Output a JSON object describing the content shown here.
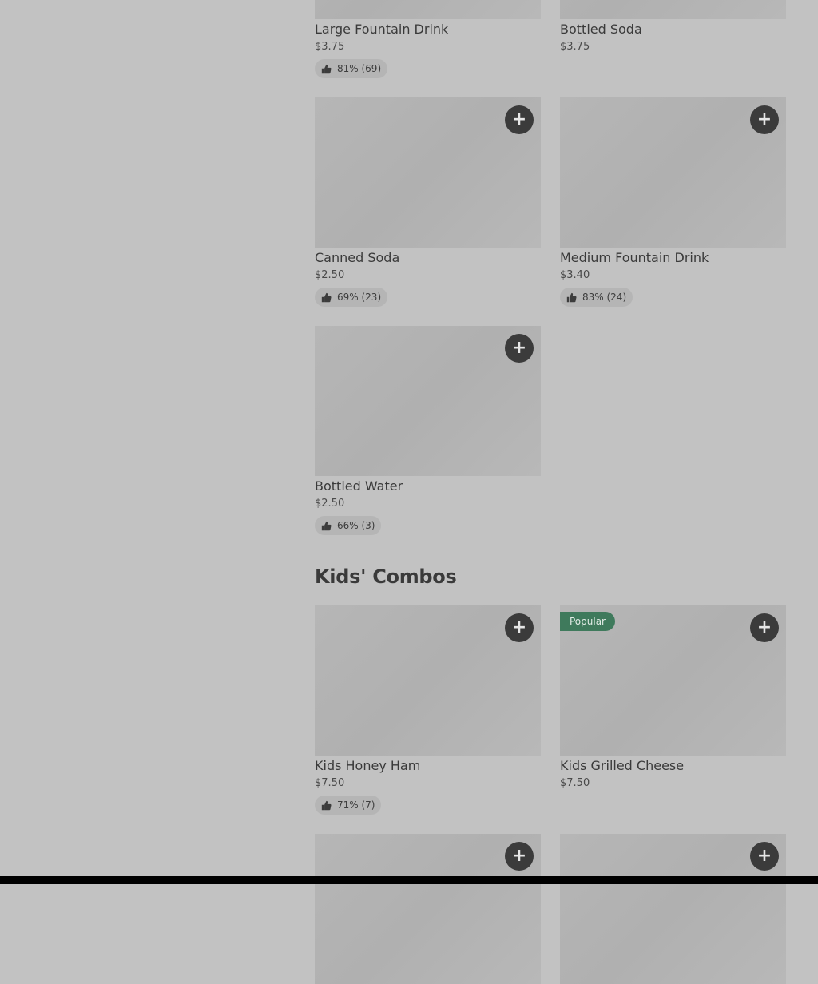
{
  "drinks": {
    "items": [
      {
        "name": "Large Fountain Drink",
        "price": "$3.75",
        "rating": "81% (69)"
      },
      {
        "name": "Bottled Soda",
        "price": "$3.75"
      },
      {
        "name": "Canned Soda",
        "price": "$2.50",
        "rating": "69% (23)"
      },
      {
        "name": "Medium Fountain Drink",
        "price": "$3.40",
        "rating": "83% (24)"
      },
      {
        "name": "Bottled Water",
        "price": "$2.50",
        "rating": "66% (3)"
      }
    ]
  },
  "kids_combos": {
    "title": "Kids' Combos",
    "items": [
      {
        "name": "Kids Honey Ham",
        "price": "$7.50",
        "rating": "71% (7)"
      },
      {
        "name": "Kids Grilled Cheese",
        "price": "$7.50",
        "badge": "Popular"
      }
    ]
  },
  "icons": {
    "add": "plus-icon",
    "rating": "thumbs-up-icon"
  },
  "colors": {
    "add_button": "#3b3b3b",
    "popular_badge": "#3f7a5c",
    "background": "#c2c2c2"
  }
}
